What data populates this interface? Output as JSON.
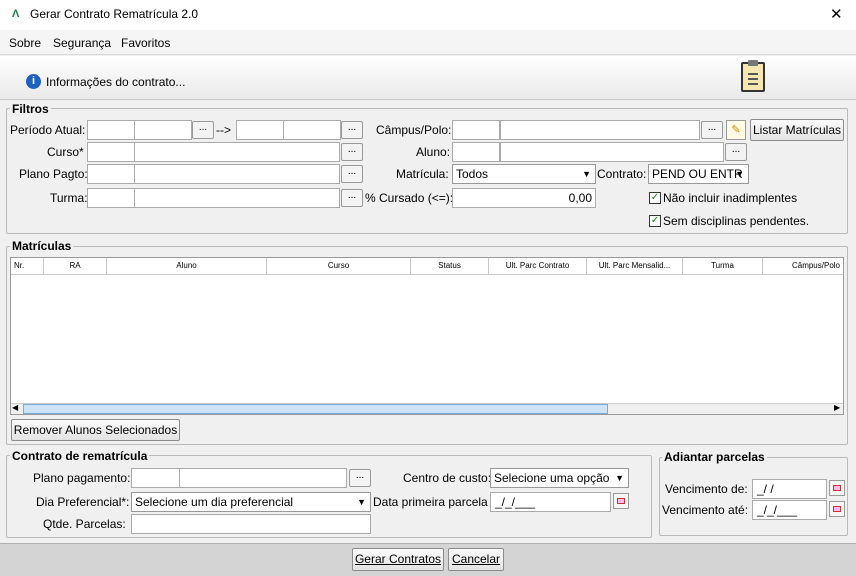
{
  "window": {
    "title": "Gerar Contrato Rematrícula 2.0",
    "close": "✕"
  },
  "menu": [
    "Sobre",
    "Segurança",
    "Favoritos"
  ],
  "banner": {
    "info": "Informações do contrato..."
  },
  "filtros": {
    "legend": "Filtros",
    "periodo_label": "Período Atual:",
    "arrow": "-->",
    "curso_label": "Curso*",
    "plano_label": "Plano Pagto:",
    "turma_label": "Turma:",
    "campus_label": "Câmpus/Polo:",
    "aluno_label": "Aluno:",
    "matricula_label": "Matrícula:",
    "matricula_value": "Todos",
    "contrato_label": "Contrato:",
    "contrato_value": "PEND OU ENTR",
    "cursado_label": "% Cursado (<=):",
    "cursado_value": "0,00",
    "listar_button": "Listar Matrículas",
    "nao_incluir": "Não incluir inadimplentes",
    "sem_disciplinas": "Sem disciplinas pendentes.",
    "dots": "..."
  },
  "matriculas": {
    "legend": "Matrículas",
    "columns": [
      "Nr.",
      "RA",
      "Aluno",
      "Curso",
      "Status",
      "Ult. Parc Contrato",
      "Ult. Parc Mensalid...",
      "Turma",
      "Câmpus/Polo"
    ],
    "remove_button": "Remover Alunos Selecionados"
  },
  "contrato": {
    "legend": "Contrato de rematrícula",
    "plano_label": "Plano pagamento:",
    "dia_label": "Dia Preferencial*:",
    "dia_value": "Selecione um dia preferencial",
    "qtde_label": "Qtde. Parcelas:",
    "centro_label": "Centro de custo:",
    "centro_value": "Selecione uma opção",
    "data_label": "Data primeira parcela",
    "data_value": "_/_/___"
  },
  "adiantar": {
    "legend": "Adiantar parcelas",
    "venc_de_label": "Vencimento de:",
    "venc_de_value": "_/ /",
    "venc_ate_label": "Vencimento até:",
    "venc_ate_value": "_/_/___"
  },
  "footer": {
    "gerar": "Gerar Contratos",
    "cancelar": "Cancelar"
  }
}
